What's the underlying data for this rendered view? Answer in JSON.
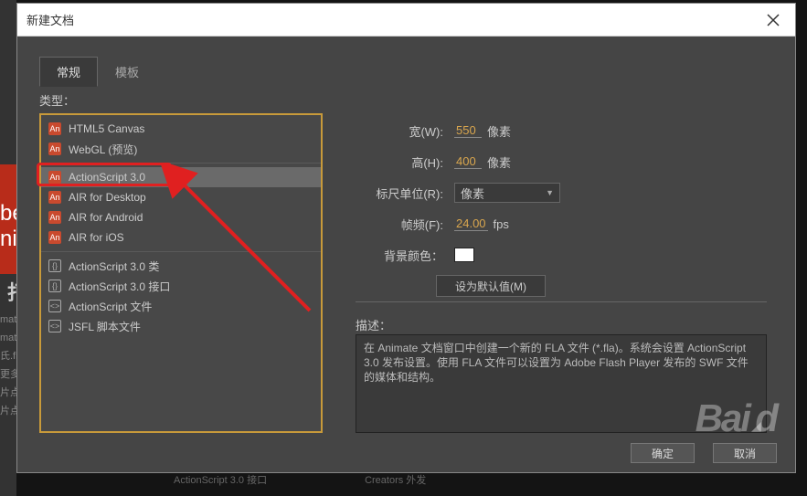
{
  "dialog": {
    "title": "新建文档"
  },
  "tabs": {
    "general": "常规",
    "template": "模板"
  },
  "labels": {
    "type": "类型：",
    "desc": "描述："
  },
  "types": {
    "group1": [
      {
        "icon": "An",
        "label": "HTML5 Canvas"
      },
      {
        "icon": "An",
        "label": "WebGL (预览)"
      }
    ],
    "group2": [
      {
        "icon": "An",
        "label": "ActionScript 3.0",
        "selected": true
      },
      {
        "icon": "An",
        "label": "AIR for Desktop"
      },
      {
        "icon": "An",
        "label": "AIR for Android"
      },
      {
        "icon": "An",
        "label": "AIR for iOS"
      }
    ],
    "group3": [
      {
        "icon": "{}",
        "label": "ActionScript 3.0 类"
      },
      {
        "icon": "{}",
        "label": "ActionScript 3.0 接口"
      },
      {
        "icon": "<>",
        "label": "ActionScript 文件"
      },
      {
        "icon": "<>",
        "label": "JSFL 脚本文件"
      }
    ]
  },
  "props": {
    "width_label": "宽(W):",
    "width_value": "550",
    "px": "像素",
    "height_label": "高(H):",
    "height_value": "400",
    "ruler_label": "标尺单位(R):",
    "ruler_value": "像素",
    "fps_label": "帧频(F):",
    "fps_value": "24.00",
    "fps_unit": "fps",
    "bg_label": "背景颜色：",
    "default_btn": "设为默认值(M)"
  },
  "description": "在 Animate 文档窗口中创建一个新的 FLA 文件 (*.fla)。系统会设置 ActionScript 3.0 发布设置。使用 FLA 文件可以设置为 Adobe Flash Player 发布的 SWF 文件的媒体和结构。",
  "buttons": {
    "ok": "确定",
    "cancel": "取消"
  },
  "bg": {
    "abbr": "be",
    "name": "ni",
    "open": "打",
    "rows": [
      "mat",
      "mat",
      "氏.fl",
      "更多",
      "片点",
      "片点"
    ],
    "foot1": "ActionScript 3.0 接口",
    "foot2": "Creators 外发"
  }
}
